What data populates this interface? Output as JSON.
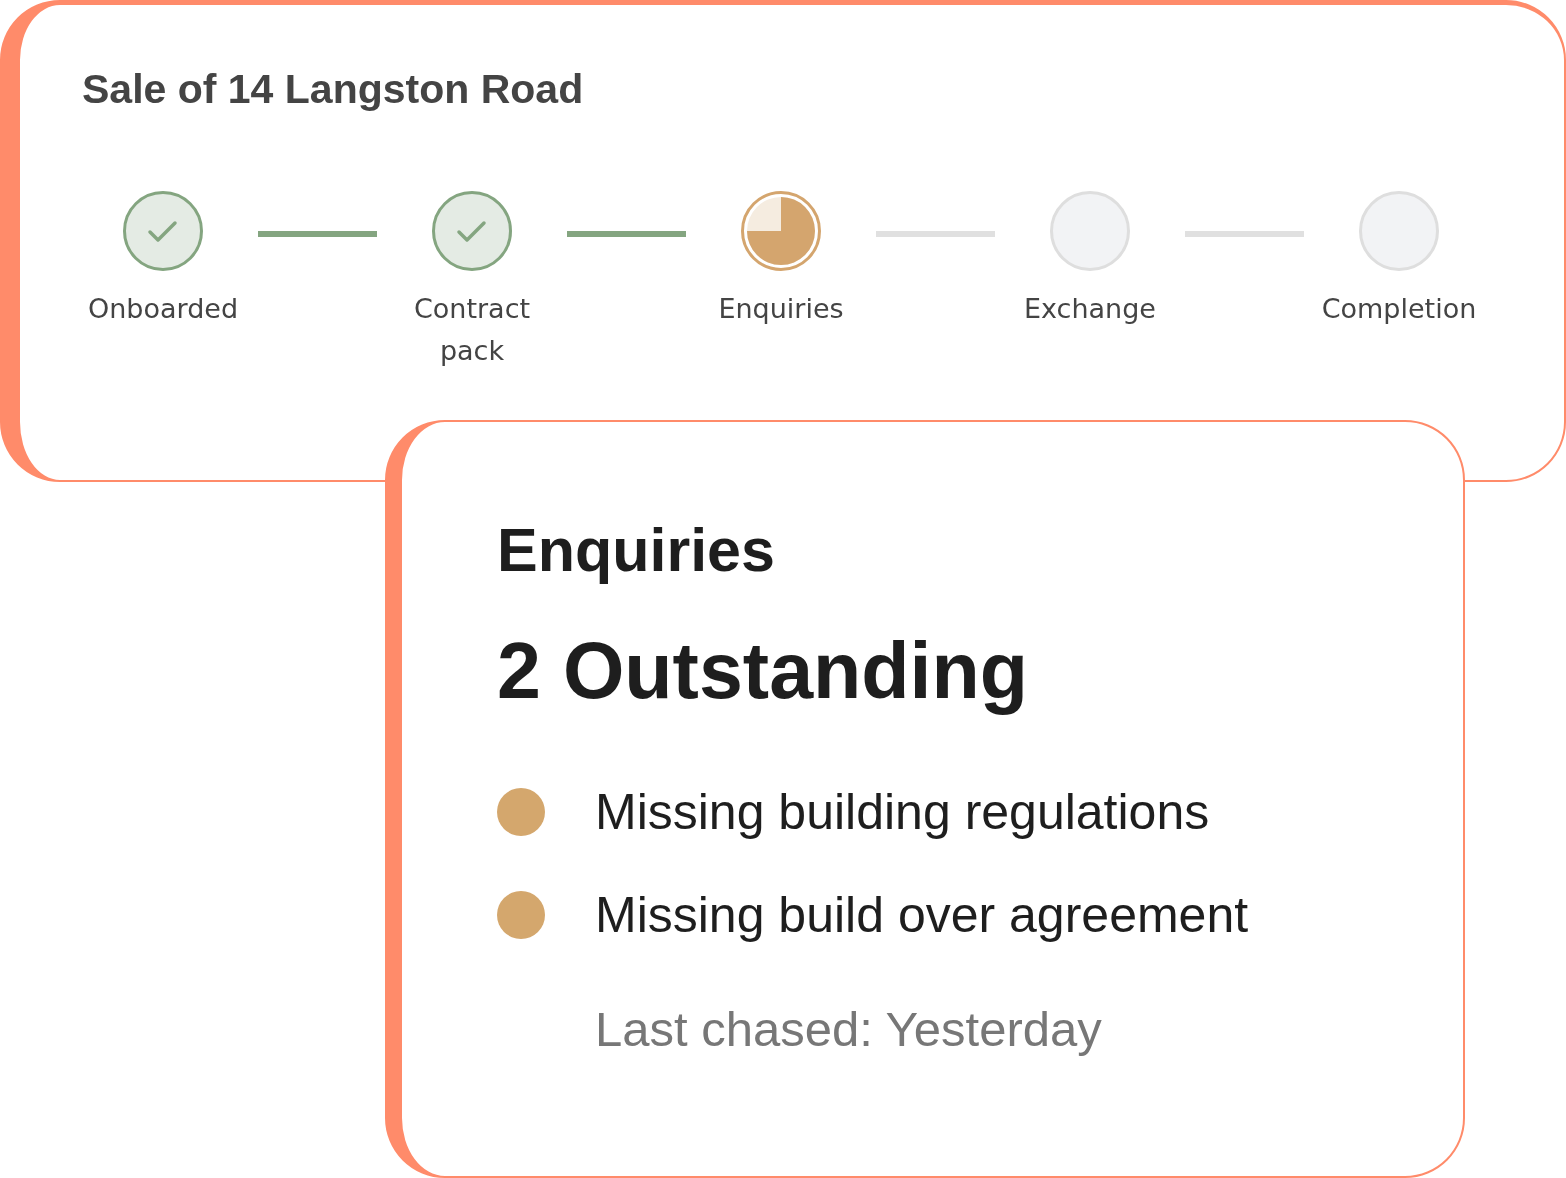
{
  "sale": {
    "title": "Sale of 14 Langston Road",
    "steps": [
      {
        "label": "Onboarded",
        "kind": "done"
      },
      {
        "label": "Contract pack",
        "kind": "done"
      },
      {
        "label": "Enquiries",
        "kind": "current"
      },
      {
        "label": "Exchange",
        "kind": "pending"
      },
      {
        "label": "Completion",
        "kind": "pending"
      }
    ]
  },
  "enquiries": {
    "heading": "Enquiries",
    "summary": "2 Outstanding",
    "items": [
      {
        "text": "Missing building regulations"
      },
      {
        "text": "Missing build over agreement"
      }
    ],
    "last_chased": "Last chased: Yesterday"
  }
}
